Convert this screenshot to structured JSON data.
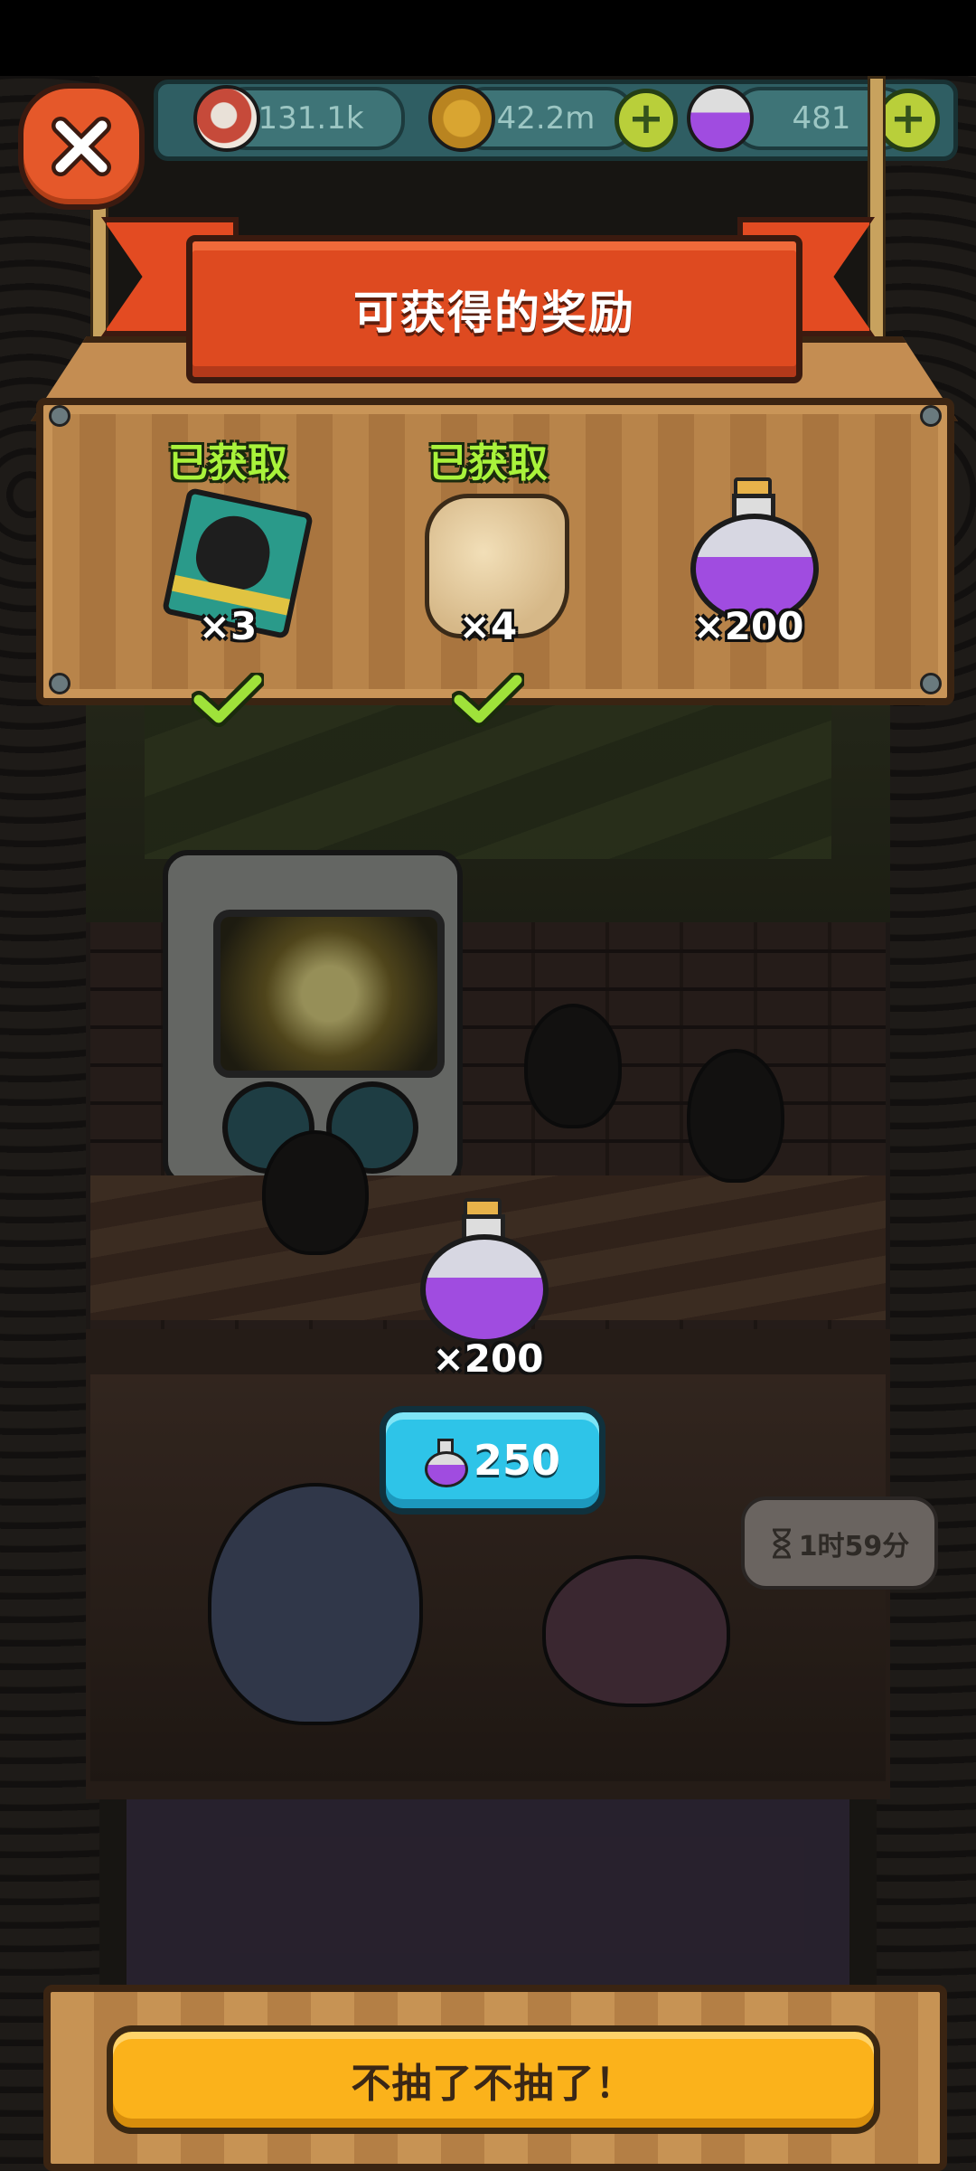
{
  "currency": {
    "eyeballs": "131.1k",
    "coins": "42.2m",
    "potions": "481"
  },
  "banner": {
    "title": "可获得的奖励"
  },
  "rewards": [
    {
      "status": "已获取",
      "quantity": "×3",
      "icon": "card-icon",
      "claimed": true
    },
    {
      "status": "已获取",
      "quantity": "×4",
      "icon": "scroll-icon",
      "claimed": true
    },
    {
      "status": "",
      "quantity": "×200",
      "icon": "potion-icon",
      "claimed": false
    }
  ],
  "draw": {
    "reward_quantity": "×200",
    "price": "250"
  },
  "timer": {
    "text": "1时59分"
  },
  "quit_button": {
    "label": "不抽了不抽了！"
  },
  "colors": {
    "banner": "#de4a20",
    "price_button": "#2ec4e8",
    "quit_button": "#fbb21b",
    "claimed_text": "#a9f33b",
    "potion": "#a04ce0"
  }
}
